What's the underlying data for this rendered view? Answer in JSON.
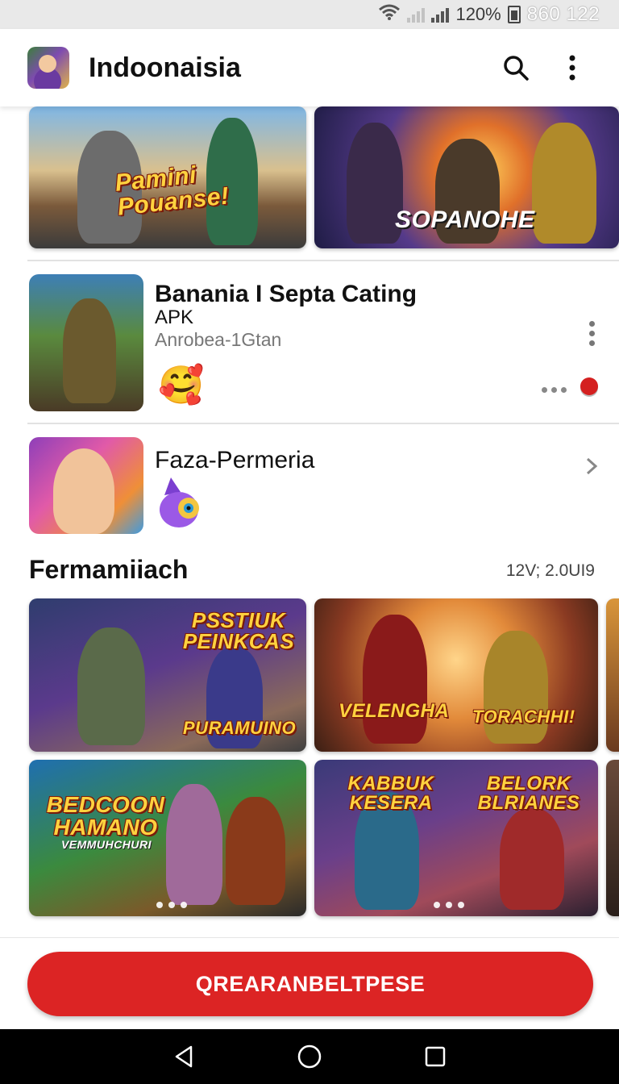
{
  "status_bar": {
    "battery_percent": "120%",
    "time": "860 122",
    "icons": [
      "wifi-icon",
      "signal-icon",
      "signal-icon",
      "battery-icon"
    ]
  },
  "app_bar": {
    "title": "Indoonaisia",
    "icons": [
      "app-logo",
      "search-icon",
      "more-vert-icon"
    ]
  },
  "banners": [
    {
      "text": "Pamini Pouanse!"
    },
    {
      "text": "SOPANOHE"
    }
  ],
  "list": [
    {
      "title": "Banania I Septa Cating",
      "subtitle_1": "APK",
      "subtitle_2": "Anrobea-1Gtan",
      "emoji": "🥰",
      "icons": [
        "more-vert-icon",
        "more-horiz-icon",
        "red-dot-icon"
      ]
    },
    {
      "title": "Faza-Permeria",
      "emoji": "🟣",
      "icons": [
        "chevron-right-icon"
      ]
    }
  ],
  "section": {
    "title": "Fermamiiach",
    "meta": "12V; 2.0UI9"
  },
  "grid": [
    {
      "title": "PSSTIUK PEINKCAS",
      "subtitle": "PURAMUINO"
    },
    {
      "title": "VELENGHA",
      "subtitle": "TORACHHI!"
    },
    {
      "title": "BEDCOON HAMANO",
      "subtitle": "VEMMUHCHURI"
    },
    {
      "title": "KABBUK KESERA",
      "subtitle": "BELORK BLRIANES"
    }
  ],
  "cta": {
    "label": "QREARANBELTPESE",
    "color": "#dc2424"
  },
  "nav_bar": {
    "icons": [
      "back-icon",
      "home-icon",
      "recents-icon"
    ]
  }
}
